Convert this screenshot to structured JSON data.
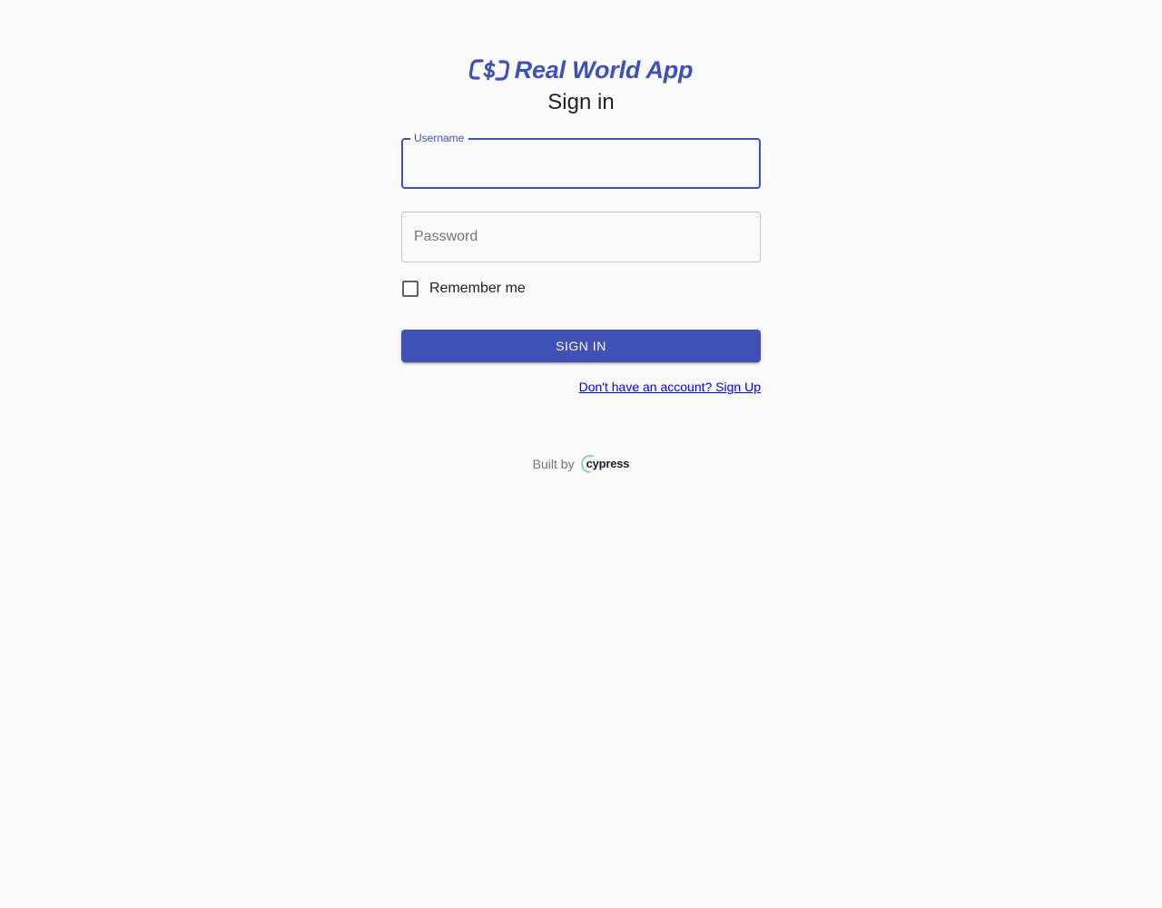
{
  "app": {
    "name": "Real World App",
    "brand_color": "#3f51b5",
    "logo_icon": "dollar-chain-icon"
  },
  "form": {
    "title": "Sign in",
    "username": {
      "label": "Username",
      "value": "",
      "focused": true
    },
    "password": {
      "placeholder": "Password",
      "value": ""
    },
    "remember": {
      "label": "Remember me",
      "checked": false
    },
    "submit_label": "Sign In",
    "signup_link": "Don't have an account? Sign Up"
  },
  "footer": {
    "built_by": "Built by",
    "brand": "cypress",
    "brand_icon": "cypress-logo-icon"
  }
}
